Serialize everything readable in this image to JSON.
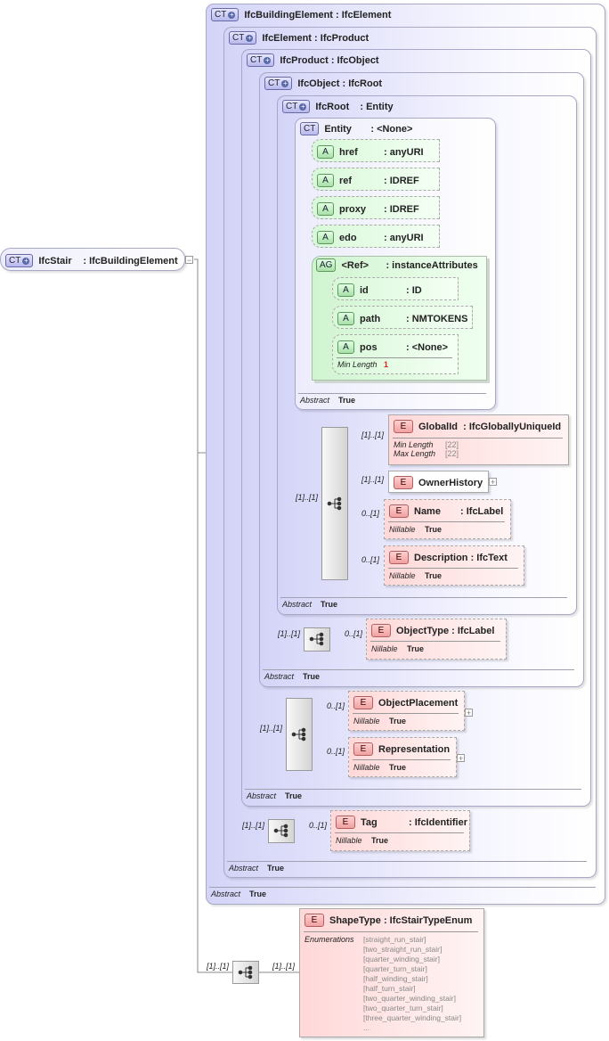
{
  "badges": {
    "complex_type": "CT",
    "attribute": "A",
    "attribute_group": "AG",
    "element": "E"
  },
  "root": {
    "name": "IfcStair",
    "type": ": IfcBuildingElement",
    "collapse": "−"
  },
  "complex_types": [
    {
      "name": "IfcBuildingElement",
      "type": ": IfcElement",
      "abstract_label": "Abstract",
      "abstract_value": "True"
    },
    {
      "name": "IfcElement",
      "type": ": IfcProduct",
      "abstract_label": "Abstract",
      "abstract_value": "True"
    },
    {
      "name": "IfcProduct",
      "type": ": IfcObject",
      "abstract_label": "Abstract",
      "abstract_value": "True"
    },
    {
      "name": "IfcObject",
      "type": ": IfcRoot",
      "abstract_label": "Abstract",
      "abstract_value": "True"
    },
    {
      "name": "IfcRoot",
      "type": ": Entity",
      "abstract_label": "Abstract",
      "abstract_value": "True"
    },
    {
      "name": "Entity",
      "type": ": <None>",
      "abstract_label": "Abstract",
      "abstract_value": "True"
    }
  ],
  "attributes": [
    {
      "name": "href",
      "type": ": anyURI"
    },
    {
      "name": "ref",
      "type": ": IDREF"
    },
    {
      "name": "proxy",
      "type": ": IDREF"
    },
    {
      "name": "edo",
      "type": ": anyURI"
    }
  ],
  "attribute_group": {
    "name": "<Ref>",
    "type": ": instanceAttributes",
    "attributes": [
      {
        "name": "id",
        "type": ": ID"
      },
      {
        "name": "path",
        "type": ": NMTOKENS"
      },
      {
        "name": "pos",
        "type": ": <None>",
        "prop_label": "Min Length",
        "prop_value": "1"
      }
    ]
  },
  "elements": {
    "global_id": {
      "name": "GlobalId",
      "type": ": IfcGloballyUniqueId",
      "mult": "[1]..[1]",
      "min_label": "Min Length",
      "min_value": "[22]",
      "max_label": "Max Length",
      "max_value": "[22]"
    },
    "owner_history": {
      "name": "OwnerHistory",
      "mult": "[1]..[1]",
      "expand": "+"
    },
    "name": {
      "name": "Name",
      "type": ": IfcLabel",
      "mult": "0..[1]",
      "nillable_label": "Nillable",
      "nillable_value": "True"
    },
    "description": {
      "name": "Description",
      "type": ": IfcText",
      "mult": "0..[1]",
      "nillable_label": "Nillable",
      "nillable_value": "True"
    },
    "object_type": {
      "name": "ObjectType",
      "type": ": IfcLabel",
      "mult": "0..[1]",
      "nillable_label": "Nillable",
      "nillable_value": "True"
    },
    "object_placement": {
      "name": "ObjectPlacement",
      "mult": "0..[1]",
      "nillable_label": "Nillable",
      "nillable_value": "True",
      "expand": "+"
    },
    "representation": {
      "name": "Representation",
      "mult": "0..[1]",
      "nillable_label": "Nillable",
      "nillable_value": "True",
      "expand": "+"
    },
    "tag": {
      "name": "Tag",
      "type": ": IfcIdentifier",
      "mult": "0..[1]",
      "nillable_label": "Nillable",
      "nillable_value": "True"
    },
    "shape_type": {
      "name": "ShapeType",
      "type": ": IfcStairTypeEnum",
      "mult": "[1]..[1]",
      "enum_label": "Enumerations",
      "enumerations": [
        "[straight_run_stair]",
        "[two_straight_run_stair]",
        "[quarter_winding_stair]",
        "[quarter_turn_stair]",
        "[half_winding_stair]",
        "[half_turn_stair]",
        "[two_quarter_winding_stair]",
        "[two_quarter_turn_stair]",
        "[three_quarter_winding_stair]",
        "..."
      ]
    }
  },
  "sequences": {
    "root_seq": {
      "mult": "[1]..[1]"
    },
    "object_seq": {
      "mult": "[1]..[1]"
    },
    "product_seq": {
      "mult": "[1]..[1]"
    },
    "element_seq": {
      "mult": "[1]..[1]"
    },
    "stair_seq": {
      "mult": "[1]..[1]"
    }
  }
}
